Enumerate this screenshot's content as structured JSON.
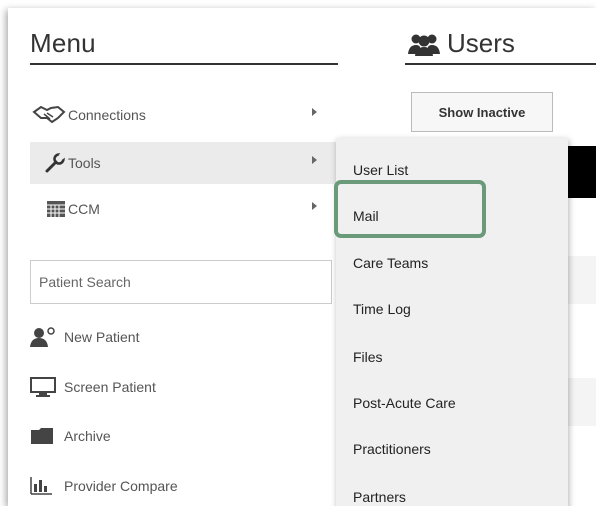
{
  "menu": {
    "title": "Menu",
    "items": [
      {
        "label": "Connections",
        "icon": "handshake-icon"
      },
      {
        "label": "Tools",
        "icon": "wrench-icon"
      },
      {
        "label": "CCM",
        "icon": "calendar-icon"
      }
    ],
    "search_placeholder": "Patient Search",
    "quick_links": [
      {
        "label": "New Patient",
        "icon": "new-patient-icon"
      },
      {
        "label": "Screen Patient",
        "icon": "monitor-icon"
      },
      {
        "label": "Archive",
        "icon": "folder-icon"
      },
      {
        "label": "Provider Compare",
        "icon": "bar-chart-icon"
      }
    ]
  },
  "users": {
    "title": "Users",
    "show_inactive_label": "Show Inactive"
  },
  "tools_submenu": {
    "items": [
      "User List",
      "Mail",
      "Care Teams",
      "Time Log",
      "Files",
      "Post-Acute Care",
      "Practitioners",
      "Partners"
    ],
    "highlighted": "Mail"
  },
  "colors": {
    "highlight_border": "#6b9a7b",
    "active_row": "#ebebeb",
    "submenu_bg": "#f0f0f0"
  }
}
